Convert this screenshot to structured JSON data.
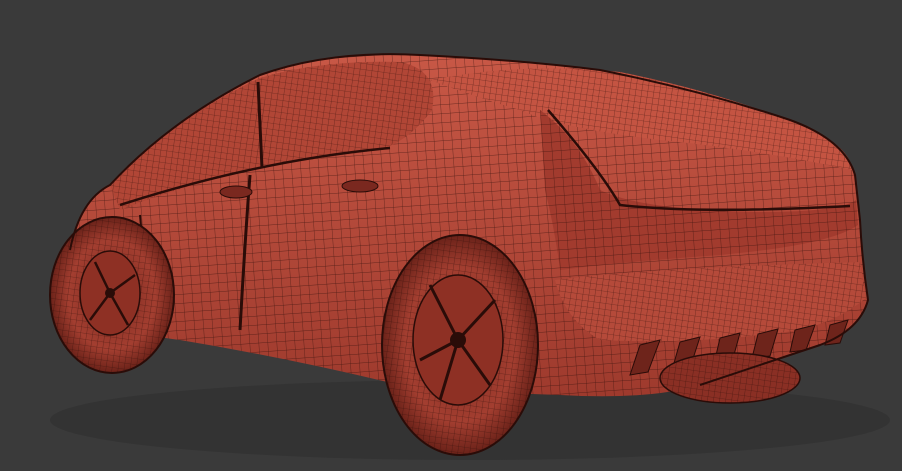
{
  "viewport": {
    "background_color": "#3a3a3a",
    "object": "car-wireframe-model",
    "shading": "red-clay",
    "wireframe": "on"
  },
  "colors": {
    "body": "#b84a3a",
    "body_light": "#cf6452",
    "body_dark": "#8a2f24",
    "shadow": "#5e1d16",
    "wire": "#2a0c08"
  }
}
